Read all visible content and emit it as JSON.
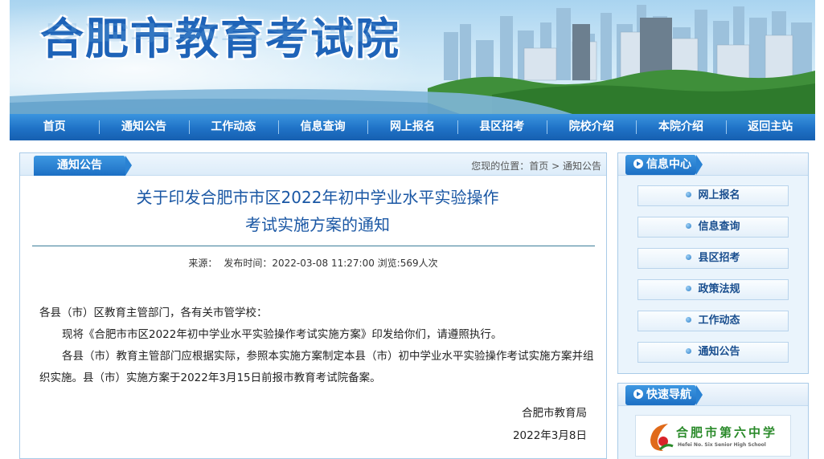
{
  "header": {
    "site_title": "合肥市教育考试院"
  },
  "nav": {
    "items": [
      "首页",
      "通知公告",
      "工作动态",
      "信息查询",
      "网上报名",
      "县区招考",
      "院校介绍",
      "本院介绍",
      "返回主站"
    ]
  },
  "main": {
    "tab_label": "通知公告",
    "breadcrumb": {
      "prefix": "您现的位置：",
      "home": "首页",
      "sep": ">",
      "current": "通知公告"
    },
    "article": {
      "title_line1": "关于印发合肥市市区2022年初中学业水平实验操作",
      "title_line2": "考试实施方案的通知",
      "source_label": "来源：",
      "publish_label": "发布时间：2022-03-08 11:27:00",
      "views_label": "浏览:569人次",
      "greeting": "各县（市）区教育主管部门，各有关市管学校：",
      "para1": "现将《合肥市市区2022年初中学业水平实验操作考试实施方案》印发给你们，请遵照执行。",
      "para2": "各县（市）教育主管部门应根据实际，参照本实施方案制定本县（市）初中学业水平实验操作考试实施方案并组织实施。县（市）实施方案于2022年3月15日前报市教育考试院备案。",
      "signer": "合肥市教育局",
      "date": "2022年3月8日"
    }
  },
  "sidebar": {
    "info_center": {
      "title": "信息中心",
      "links": [
        "网上报名",
        "信息查询",
        "县区招考",
        "政策法规",
        "工作动态",
        "通知公告"
      ]
    },
    "quick_nav": {
      "title": "快速导航",
      "logo_text": "合肥市第六中学",
      "logo_sub": "Hefei No. Six Senior High School"
    }
  },
  "colors": {
    "brand_blue": "#1f72c6",
    "title_blue": "#1a57a4",
    "panel_border": "#a9cbe8"
  }
}
